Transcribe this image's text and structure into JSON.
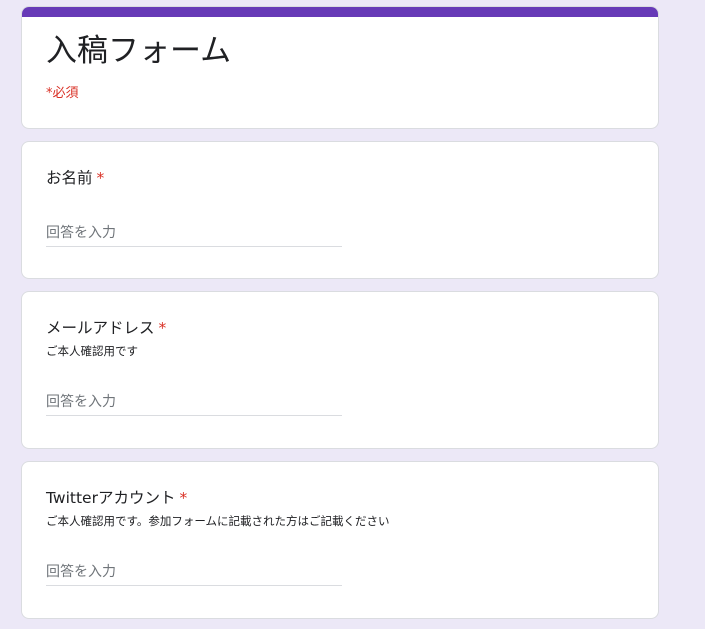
{
  "form": {
    "title": "入稿フォーム",
    "required_note": "*必須",
    "accent_color": "#673ab7",
    "background_color": "#ece8f7",
    "required_color": "#d93025"
  },
  "questions": [
    {
      "title": "お名前",
      "required_mark": "*",
      "description": "",
      "placeholder": "回答を入力",
      "value": ""
    },
    {
      "title": "メールアドレス",
      "required_mark": "*",
      "description": "ご本人確認用です",
      "placeholder": "回答を入力",
      "value": ""
    },
    {
      "title": "Twitterアカウント",
      "required_mark": "*",
      "description": "ご本人確認用です。参加フォームに記載された方はご記載ください",
      "placeholder": "回答を入力",
      "value": ""
    }
  ]
}
